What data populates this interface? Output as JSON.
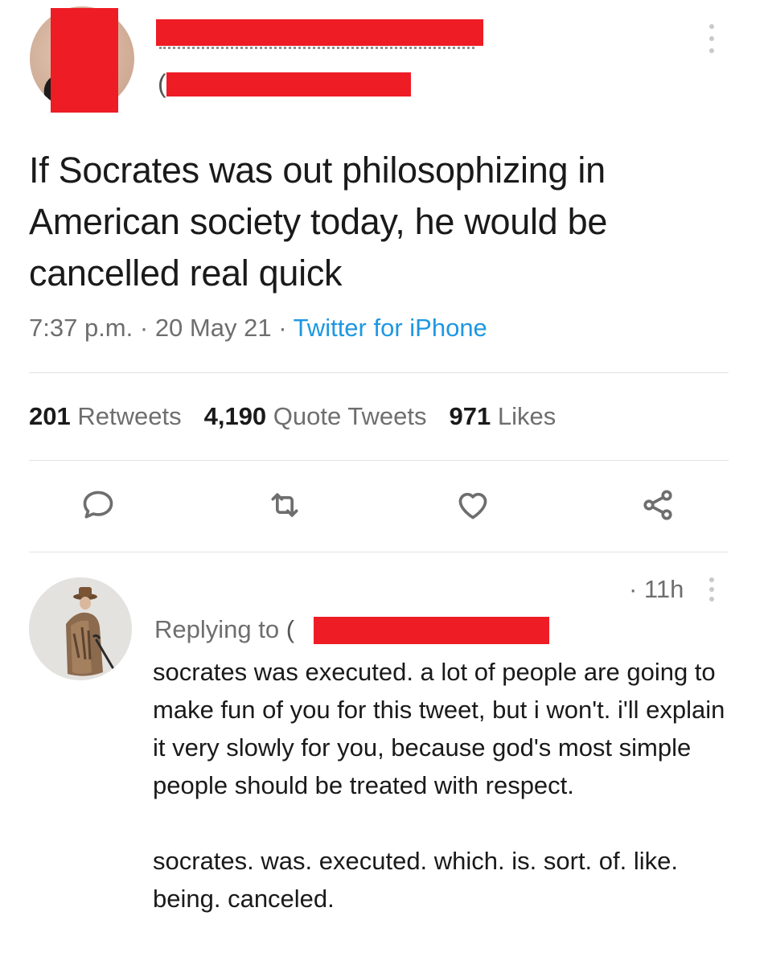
{
  "tweet": {
    "handle_open": "(",
    "text": "If Socrates was out philosophizing in American society today, he would be cancelled real quick",
    "time": "7:37 p.m.",
    "sep1": " · ",
    "date": "20 May 21",
    "sep2": " · ",
    "source": "Twitter for iPhone",
    "stats": {
      "retweets_count": "201",
      "retweets_label": "Retweets",
      "quote_count": "4,190",
      "quote_label": "Quote Tweets",
      "likes_count": "971",
      "likes_label": "Likes"
    }
  },
  "reply": {
    "time": "· 11h",
    "replying_to_label": "Replying to",
    "paren": "(",
    "paragraph1": "socrates was executed. a lot of people are going to make fun of you for this tweet, but i won't. i'll explain it very slowly for you, because god's most simple people should be treated with respect.",
    "paragraph2": "socrates. was. executed. which. is. sort. of. like. being. canceled."
  },
  "icons": {
    "reply": "speech-bubble-icon",
    "retweet": "retweet-icon",
    "like": "heart-icon",
    "share": "share-icon",
    "more": "more-vertical-icon"
  },
  "colors": {
    "redaction": "#ee1c25",
    "link": "#1e97e1",
    "muted": "#6e6e6e"
  }
}
